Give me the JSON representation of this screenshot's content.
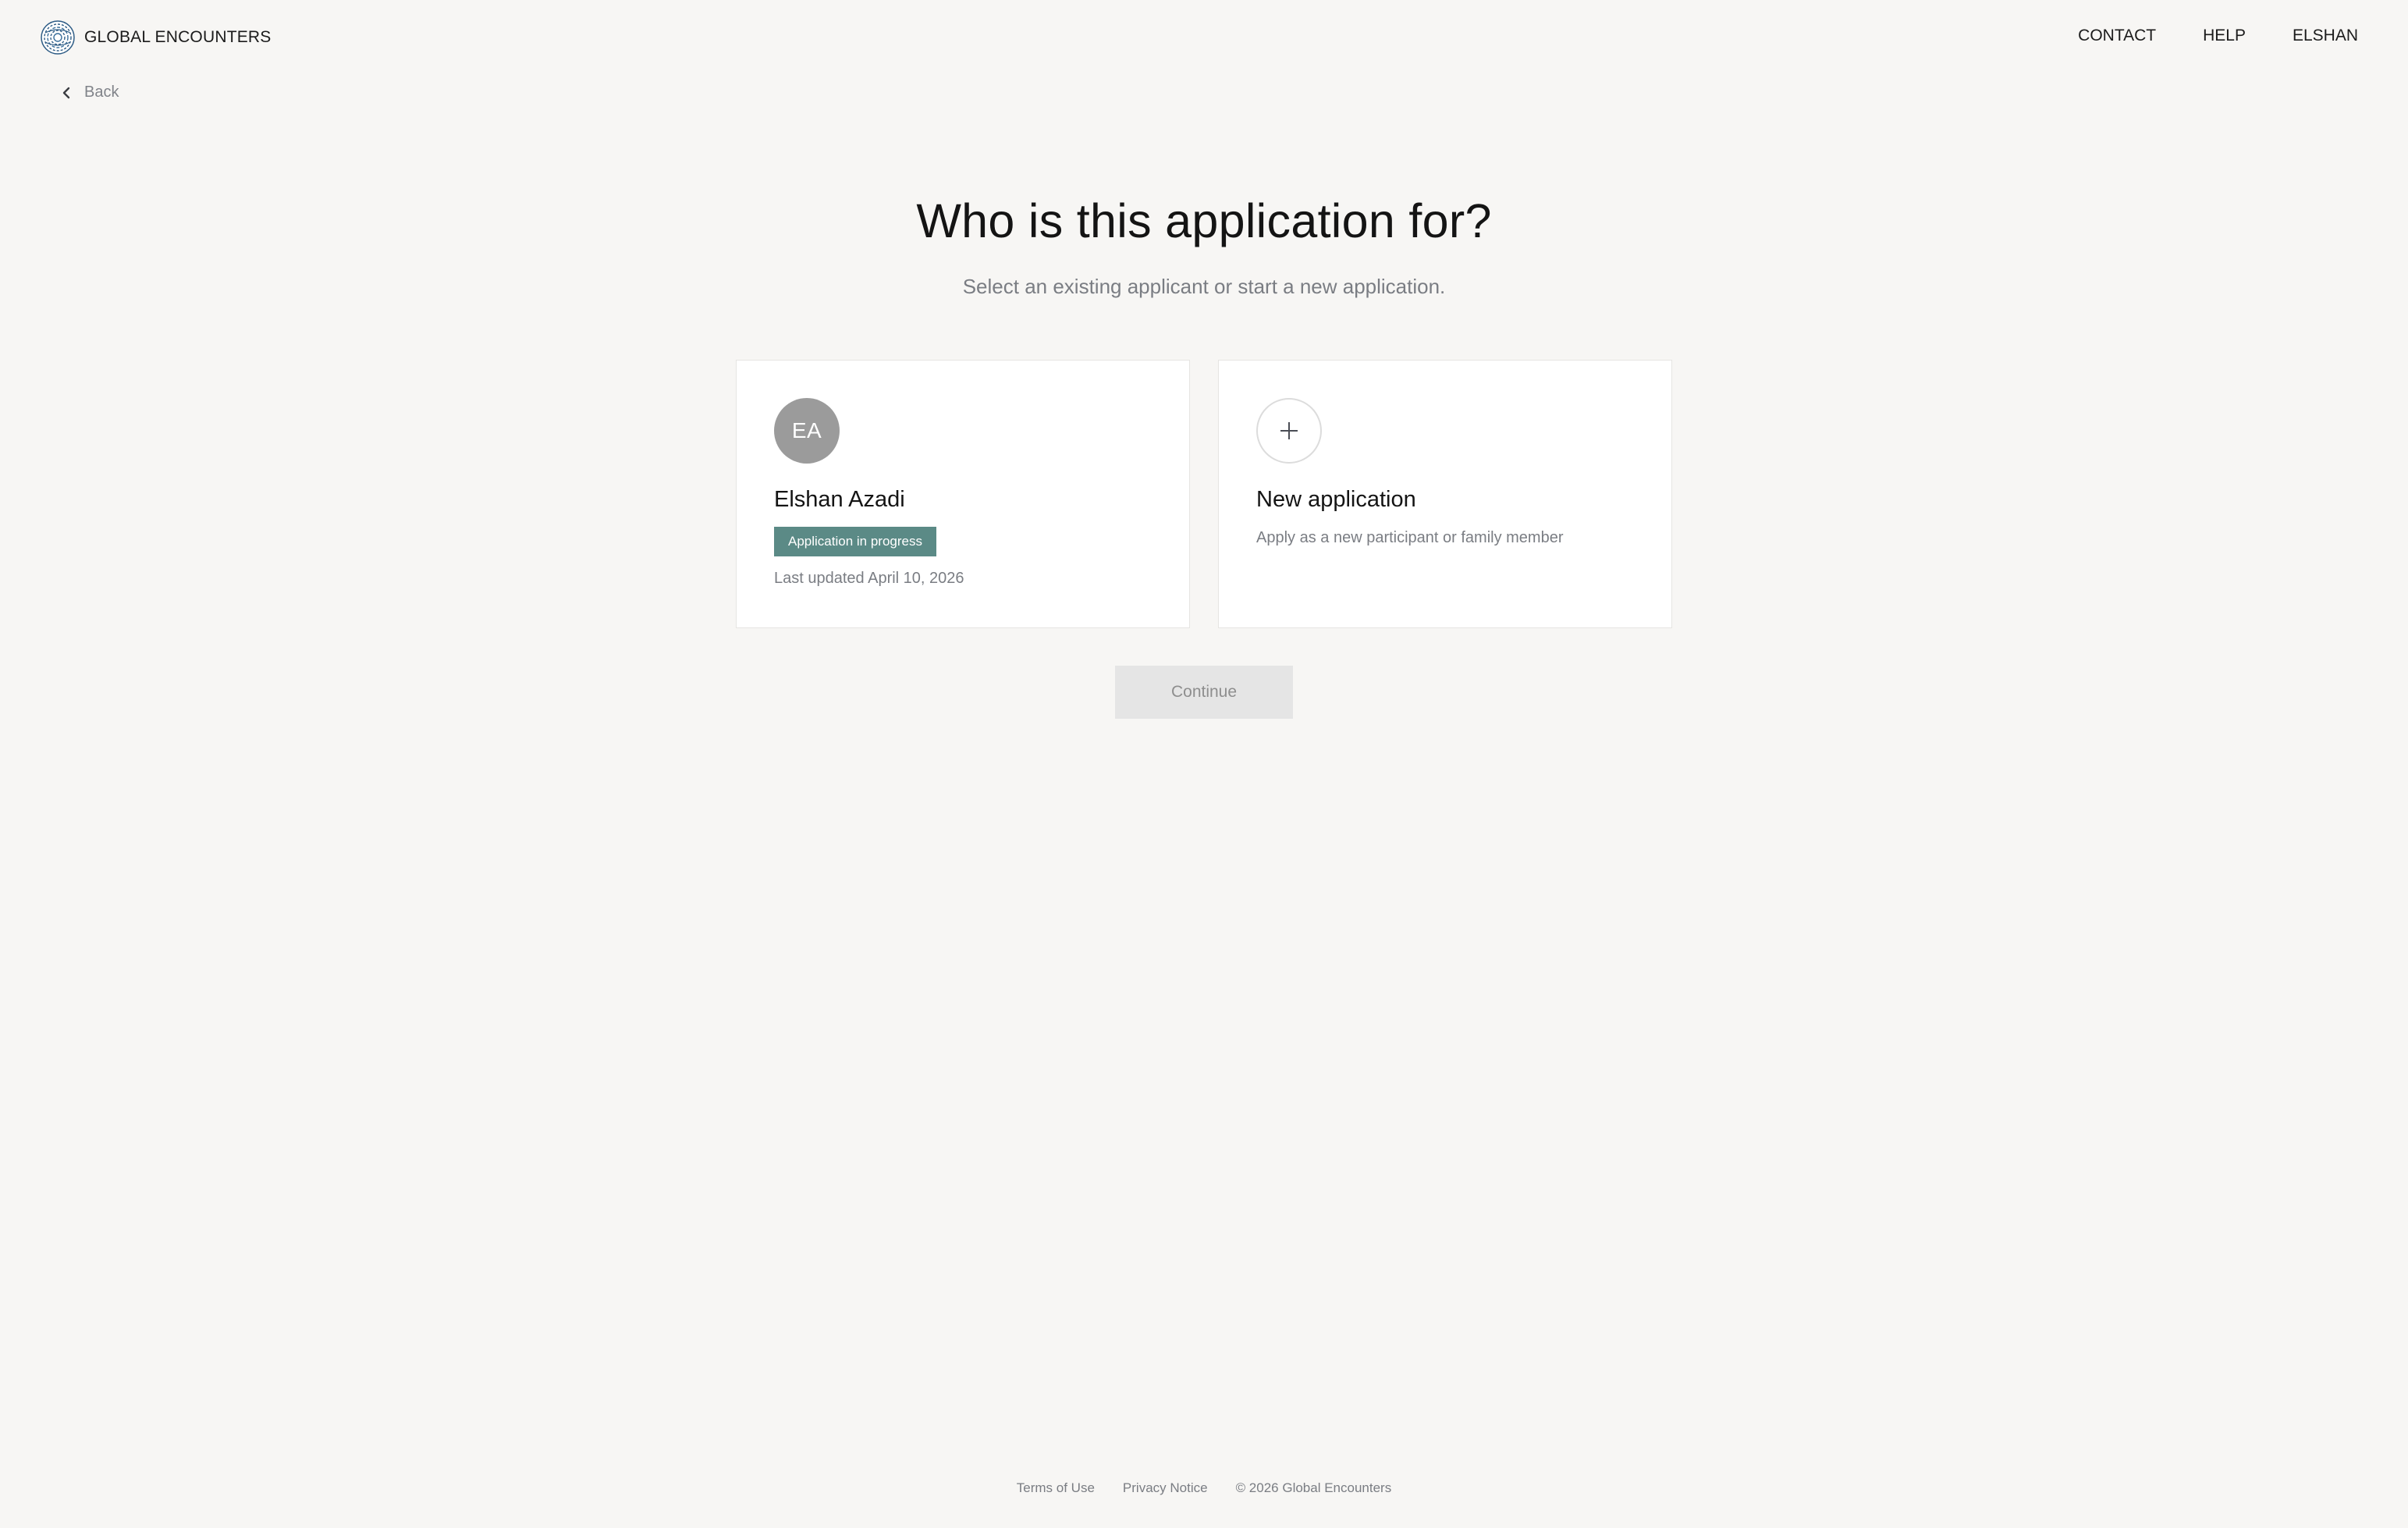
{
  "header": {
    "brand": "GLOBAL ENCOUNTERS",
    "logo_icon": "globe-fingerprint-icon",
    "brand_color": "#2f5d86",
    "nav": [
      {
        "label": "CONTACT"
      },
      {
        "label": "HELP"
      },
      {
        "label": "ELSHAN"
      }
    ]
  },
  "back": {
    "label": "Back",
    "icon": "chevron-left-icon"
  },
  "main": {
    "title": "Who is this application for?",
    "subtitle": "Select an existing applicant or start a new application.",
    "cards": {
      "existing": {
        "initials": "EA",
        "name": "Elshan Azadi",
        "status": "Application in progress",
        "status_color": "#5b8a86",
        "last_updated": "Last updated April 10, 2026"
      },
      "new": {
        "icon": "plus-icon",
        "title": "New application",
        "description": "Apply as a new participant or family member"
      }
    },
    "continue_label": "Continue",
    "continue_disabled": true
  },
  "footer": {
    "terms": "Terms of Use",
    "privacy": "Privacy Notice",
    "copyright": "© 2026 Global Encounters"
  }
}
